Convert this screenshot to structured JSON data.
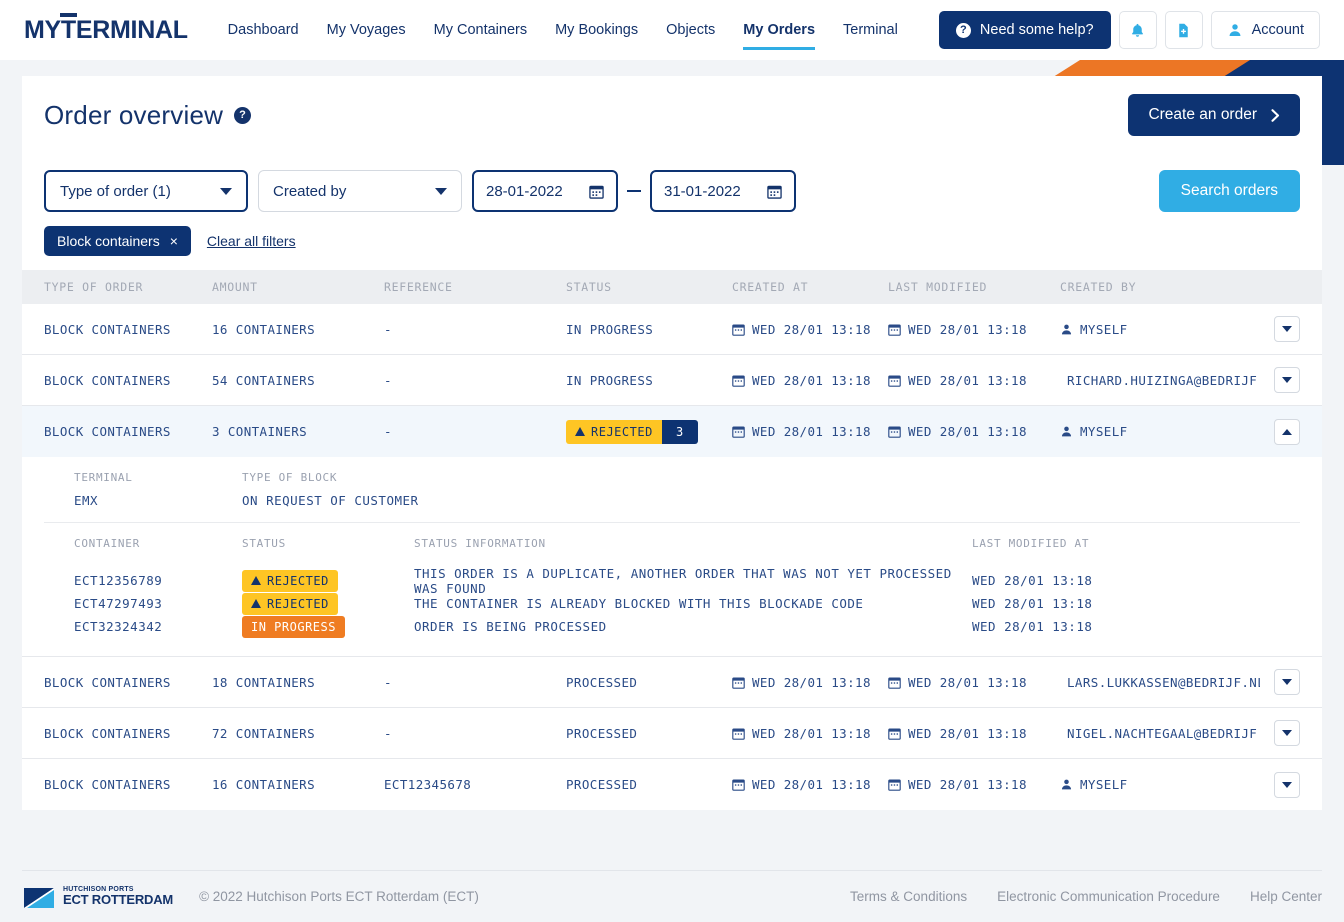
{
  "brand": {
    "logo_prefix": "MY",
    "logo_t": "T",
    "logo_suffix": "ERMINAL"
  },
  "nav": {
    "items": [
      {
        "label": "Dashboard",
        "active": false
      },
      {
        "label": "My Voyages",
        "active": false
      },
      {
        "label": "My Containers",
        "active": false
      },
      {
        "label": "My Bookings",
        "active": false
      },
      {
        "label": "Objects",
        "active": false
      },
      {
        "label": "My Orders",
        "active": true
      },
      {
        "label": "Terminal",
        "active": false
      }
    ],
    "help_button": "Need some help?",
    "notifications_icon": "bell-icon",
    "documents_icon": "document-add-icon",
    "account_label": "Account",
    "account_icon": "user-icon"
  },
  "header": {
    "title": "Order overview",
    "help_icon": "question-mark-icon",
    "create_button": "Create an order",
    "create_button_icon": "chevron-right-icon"
  },
  "filters": {
    "type_of_order": "Type of order (1)",
    "created_by": "Created by",
    "date_from": "28-01-2022",
    "date_to": "31-01-2022",
    "calendar_icon": "calendar-icon",
    "search_button": "Search orders",
    "active_chip": "Block containers",
    "chip_remove_icon": "close-icon",
    "clear_all": "Clear all filters"
  },
  "table": {
    "columns": [
      "TYPE OF ORDER",
      "AMOUNT",
      "REFERENCE",
      "STATUS",
      "CREATED AT",
      "LAST MODIFIED",
      "CREATED BY"
    ],
    "rows": [
      {
        "type": "BLOCK CONTAINERS",
        "amount": "16 CONTAINERS",
        "reference": "-",
        "status": "IN PROGRESS",
        "status_style": "plain",
        "created_at": "WED 28/01 13:18",
        "last_modified": "WED 28/01 13:18",
        "created_by": "MYSELF",
        "created_by_icon": "user-icon",
        "expanded": false
      },
      {
        "type": "BLOCK CONTAINERS",
        "amount": "54 CONTAINERS",
        "reference": "-",
        "status": "IN PROGRESS",
        "status_style": "plain",
        "created_at": "WED 28/01 13:18",
        "last_modified": "WED 28/01 13:18",
        "created_by": "RICHARD.HUIZINGA@BEDRIJF.NL",
        "created_by_icon": "company-icon",
        "expanded": false
      },
      {
        "type": "BLOCK CONTAINERS",
        "amount": "3 CONTAINERS",
        "reference": "-",
        "status": "REJECTED",
        "status_style": "rejected",
        "status_count": "3",
        "created_at": "WED 28/01 13:18",
        "last_modified": "WED 28/01 13:18",
        "created_by": "MYSELF",
        "created_by_icon": "user-icon",
        "expanded": true
      },
      {
        "type": "BLOCK CONTAINERS",
        "amount": "18 CONTAINERS",
        "reference": "-",
        "status": "PROCESSED",
        "status_style": "plain",
        "created_at": "WED 28/01 13:18",
        "last_modified": "WED 28/01 13:18",
        "created_by": "LARS.LUKKASSEN@BEDRIJF.NL",
        "created_by_icon": "company-icon",
        "expanded": false
      },
      {
        "type": "BLOCK CONTAINERS",
        "amount": "72 CONTAINERS",
        "reference": "-",
        "status": "PROCESSED",
        "status_style": "plain",
        "created_at": "WED 28/01 13:18",
        "last_modified": "WED 28/01 13:18",
        "created_by": "NIGEL.NACHTEGAAL@BEDRIJF.NL",
        "created_by_icon": "company-icon",
        "expanded": false
      },
      {
        "type": "BLOCK CONTAINERS",
        "amount": "16 CONTAINERS",
        "reference": "ECT12345678",
        "status": "PROCESSED",
        "status_style": "plain",
        "created_at": "WED 28/01 13:18",
        "last_modified": "WED 28/01 13:18",
        "created_by": "MYSELF",
        "created_by_icon": "user-icon",
        "expanded": false
      }
    ]
  },
  "expansion": {
    "terminal_label": "TERMINAL",
    "terminal_value": "EMX",
    "type_of_block_label": "TYPE OF BLOCK",
    "type_of_block_value": "ON REQUEST OF CUSTOMER",
    "sub_columns": [
      "CONTAINER",
      "STATUS",
      "STATUS INFORMATION",
      "LAST MODIFIED AT"
    ],
    "containers": [
      {
        "container": "ECT12356789",
        "status": "REJECTED",
        "status_style": "rejected",
        "info": "THIS ORDER IS A DUPLICATE, ANOTHER ORDER THAT WAS NOT YET PROCESSED WAS FOUND",
        "modified": "WED 28/01 13:18"
      },
      {
        "container": "ECT47297493",
        "status": "REJECTED",
        "status_style": "rejected",
        "info": "THE CONTAINER IS ALREADY BLOCKED WITH THIS BLOCKADE CODE",
        "modified": "WED 28/01 13:18"
      },
      {
        "container": "ECT32324342",
        "status": "IN PROGRESS",
        "status_style": "inprogress",
        "info": "ORDER IS BEING PROCESSED",
        "modified": "WED 28/01 13:18"
      }
    ]
  },
  "footer": {
    "logo_line1": "HUTCHISON PORTS",
    "logo_line2": "ECT ROTTERDAM",
    "copyright": "© 2022 Hutchison Ports ECT Rotterdam (ECT)",
    "links": [
      "Terms & Conditions",
      "Electronic Communication Procedure",
      "Help Center"
    ]
  },
  "colors": {
    "navy": "#0d3372",
    "brand_navy": "#14336b",
    "cyan": "#30ade4",
    "orange": "#ef7c22",
    "yellow": "#fec524",
    "page_bg": "#f2f4f7"
  }
}
